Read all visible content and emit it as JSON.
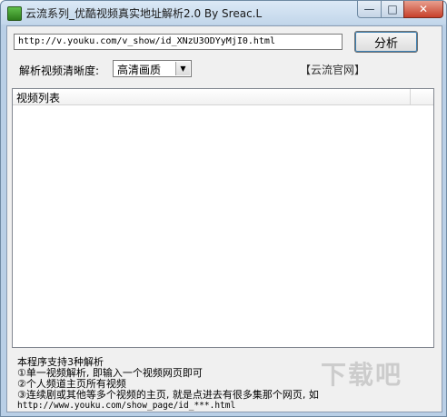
{
  "window": {
    "title": "云流系列_优酷视频真实地址解析2.0  By Sreac.L",
    "controls": {
      "minimize": "—",
      "maximize": "□",
      "close": "✕"
    }
  },
  "url_field": {
    "value": "http://v.youku.com/v_show/id_XNzU3ODYyMjI0.html"
  },
  "parse_button": {
    "label": "分析"
  },
  "quality": {
    "label": "解析视频清晰度:",
    "selected": "高清画质"
  },
  "official_link": "【云流官网】",
  "video_list": {
    "column_header": "视频列表",
    "rows": []
  },
  "help": {
    "lines": [
      "本程序支持3种解析",
      "①单一视频解析, 即输入一个视频网页即可",
      "②个人频道主页所有视频",
      "③连续剧或其他等多个视频的主页, 就是点进去有很多集那个网页, 如"
    ],
    "example_url": "http://www.youku.com/show_page/id_***.html"
  },
  "watermark": "下载吧",
  "colors": {
    "frame": "#b9cfe6",
    "close_button": "#c7402a",
    "client": "#f0f0f0"
  }
}
